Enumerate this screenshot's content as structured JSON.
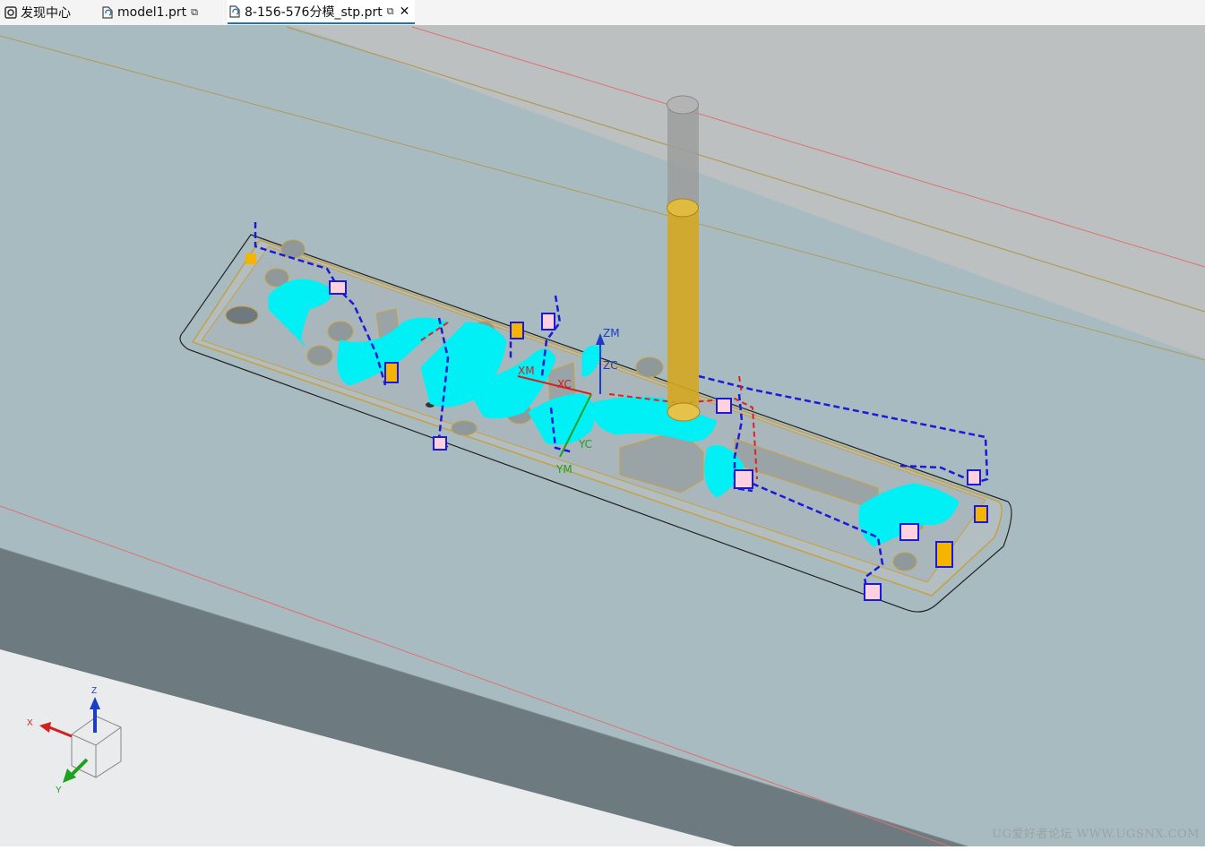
{
  "tabs": [
    {
      "label": "发现中心",
      "icon": "discovery-icon",
      "active": false
    },
    {
      "label": "model1.prt",
      "icon": "part-file-icon",
      "active": false
    },
    {
      "label": "8-156-576分模_stp.prt",
      "icon": "part-file-icon",
      "active": true
    }
  ],
  "csys_labels": {
    "zm": "ZM",
    "zc": "ZC",
    "xm": "XM",
    "xc": "XC",
    "yc": "YC",
    "ym": "YM"
  },
  "triad": {
    "x": "X",
    "y": "Y",
    "z": "Z"
  },
  "watermark": "UG爱好者论坛 WWW.UGSNX.COM",
  "colors": {
    "background": "#a9bcc2",
    "toolpath_cut": "#00f0f5",
    "toolpath_rapid": "#1a1ad8",
    "engage_red": "#e02020",
    "tool_holder": "#9c9c9c",
    "tool_body": "#d4a720",
    "part_edge": "#c8a040"
  }
}
